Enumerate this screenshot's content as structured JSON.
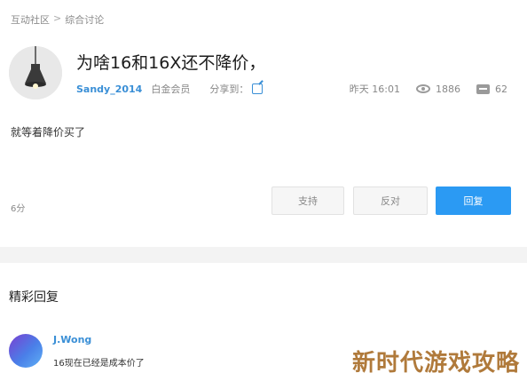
{
  "breadcrumb": {
    "root": "互动社区",
    "separator": ">",
    "current": "综合讨论"
  },
  "post": {
    "title": "为啥16和16X还不降价，",
    "author": "Sandy_2014",
    "member_level": "白金会员",
    "share_label": "分享到：",
    "time": "昨天 16:01",
    "views": "1886",
    "comments": "62",
    "body": "就等着降价买了",
    "score": "6分"
  },
  "actions": {
    "support_label": "支持",
    "oppose_label": "反对",
    "reply_label": "回复",
    "accent": "#2b9af3"
  },
  "replies_section": {
    "title": "精彩回复",
    "items": [
      {
        "user": "J.Wong",
        "text": "16现在已经是成本价了"
      }
    ]
  },
  "overlay": {
    "watermark": "新时代游戏攻略"
  },
  "icons": {
    "share": "share-icon",
    "views": "eye-icon",
    "comments": "comment-icon"
  }
}
